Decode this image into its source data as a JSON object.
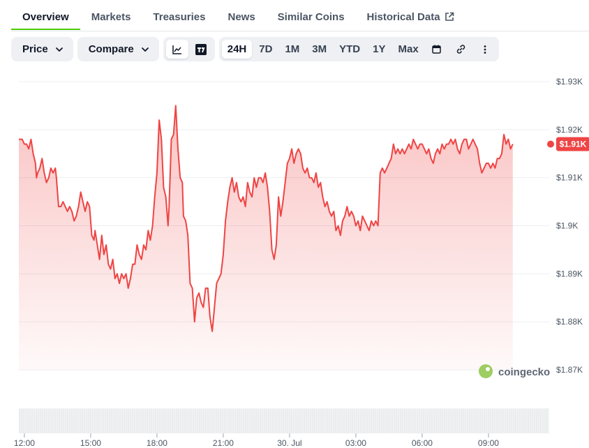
{
  "tabs": [
    {
      "label": "Overview",
      "active": true
    },
    {
      "label": "Markets"
    },
    {
      "label": "Treasuries"
    },
    {
      "label": "News"
    },
    {
      "label": "Similar Coins"
    },
    {
      "label": "Historical Data",
      "external": true
    }
  ],
  "toolbar": {
    "price_label": "Price",
    "compare_label": "Compare",
    "ranges": [
      "24H",
      "7D",
      "1M",
      "3M",
      "YTD",
      "1Y",
      "Max"
    ],
    "selected_range": "24H"
  },
  "colors": {
    "line": "#ef4444",
    "accent": "#4bcc00",
    "grid": "#eceef1"
  },
  "chart_data": {
    "type": "area",
    "ylim": [
      1870,
      1930
    ],
    "yticks": [
      1870,
      1880,
      1890,
      1900,
      1910,
      1920,
      1930
    ],
    "ytick_labels": [
      "$1.87K",
      "$1.88K",
      "$1.89K",
      "$1.9K",
      "$1.91K",
      "$1.92K",
      "$1.93K"
    ],
    "xlim": [
      11.75,
      35.75
    ],
    "xticks": [
      12,
      15,
      18,
      21,
      24,
      27,
      30,
      33
    ],
    "xtick_labels": [
      "12:00",
      "15:00",
      "18:00",
      "21:00",
      "30. Jul",
      "03:00",
      "06:00",
      "09:00"
    ],
    "current_price_label": "$1.91K",
    "watermark": "coingecko",
    "series": [
      {
        "points": [
          [
            11.75,
            1918
          ],
          [
            11.9,
            1918
          ],
          [
            12.0,
            1917
          ],
          [
            12.1,
            1917
          ],
          [
            12.2,
            1916
          ],
          [
            12.3,
            1918
          ],
          [
            12.4,
            1915
          ],
          [
            12.5,
            1913
          ],
          [
            12.55,
            1910
          ],
          [
            12.6,
            1911
          ],
          [
            12.7,
            1912
          ],
          [
            12.8,
            1914
          ],
          [
            12.9,
            1911
          ],
          [
            13.0,
            1909
          ],
          [
            13.1,
            1910
          ],
          [
            13.2,
            1912
          ],
          [
            13.3,
            1911
          ],
          [
            13.4,
            1912
          ],
          [
            13.45,
            1910
          ],
          [
            13.55,
            1904
          ],
          [
            13.65,
            1904
          ],
          [
            13.75,
            1905
          ],
          [
            13.85,
            1904
          ],
          [
            13.95,
            1903
          ],
          [
            14.05,
            1904
          ],
          [
            14.15,
            1903
          ],
          [
            14.25,
            1901
          ],
          [
            14.35,
            1902
          ],
          [
            14.45,
            1904
          ],
          [
            14.55,
            1907
          ],
          [
            14.65,
            1905
          ],
          [
            14.75,
            1903
          ],
          [
            14.85,
            1905
          ],
          [
            14.95,
            1904
          ],
          [
            15.05,
            1898
          ],
          [
            15.15,
            1897
          ],
          [
            15.2,
            1899
          ],
          [
            15.3,
            1896
          ],
          [
            15.4,
            1893
          ],
          [
            15.5,
            1898
          ],
          [
            15.6,
            1894
          ],
          [
            15.7,
            1896
          ],
          [
            15.8,
            1892
          ],
          [
            15.9,
            1891
          ],
          [
            16.0,
            1893
          ],
          [
            16.1,
            1889
          ],
          [
            16.2,
            1890
          ],
          [
            16.3,
            1888
          ],
          [
            16.4,
            1890
          ],
          [
            16.5,
            1889
          ],
          [
            16.6,
            1890
          ],
          [
            16.7,
            1887
          ],
          [
            16.8,
            1889
          ],
          [
            16.9,
            1892
          ],
          [
            17.0,
            1892
          ],
          [
            17.1,
            1896
          ],
          [
            17.2,
            1894
          ],
          [
            17.3,
            1893
          ],
          [
            17.4,
            1896
          ],
          [
            17.5,
            1895
          ],
          [
            17.6,
            1899
          ],
          [
            17.7,
            1897
          ],
          [
            17.8,
            1900
          ],
          [
            17.9,
            1906
          ],
          [
            18.0,
            1911
          ],
          [
            18.1,
            1922
          ],
          [
            18.2,
            1918
          ],
          [
            18.3,
            1908
          ],
          [
            18.4,
            1906
          ],
          [
            18.5,
            1900
          ],
          [
            18.55,
            1904
          ],
          [
            18.65,
            1918
          ],
          [
            18.75,
            1919
          ],
          [
            18.85,
            1925
          ],
          [
            18.95,
            1916
          ],
          [
            19.05,
            1910
          ],
          [
            19.15,
            1909
          ],
          [
            19.2,
            1902
          ],
          [
            19.3,
            1901
          ],
          [
            19.4,
            1898
          ],
          [
            19.5,
            1888
          ],
          [
            19.6,
            1887
          ],
          [
            19.7,
            1880
          ],
          [
            19.8,
            1885
          ],
          [
            19.9,
            1886
          ],
          [
            20.0,
            1884
          ],
          [
            20.1,
            1883
          ],
          [
            20.2,
            1887
          ],
          [
            20.3,
            1887
          ],
          [
            20.4,
            1881
          ],
          [
            20.5,
            1878
          ],
          [
            20.6,
            1883
          ],
          [
            20.7,
            1888
          ],
          [
            20.8,
            1889
          ],
          [
            20.9,
            1890
          ],
          [
            21.0,
            1894
          ],
          [
            21.1,
            1901
          ],
          [
            21.2,
            1905
          ],
          [
            21.3,
            1908
          ],
          [
            21.4,
            1910
          ],
          [
            21.5,
            1907
          ],
          [
            21.6,
            1909
          ],
          [
            21.7,
            1906
          ],
          [
            21.8,
            1905
          ],
          [
            21.9,
            1906
          ],
          [
            22.0,
            1904
          ],
          [
            22.1,
            1909
          ],
          [
            22.2,
            1907
          ],
          [
            22.3,
            1906
          ],
          [
            22.4,
            1910
          ],
          [
            22.5,
            1908
          ],
          [
            22.6,
            1910
          ],
          [
            22.7,
            1910
          ],
          [
            22.8,
            1909
          ],
          [
            22.9,
            1911
          ],
          [
            23.0,
            1908
          ],
          [
            23.1,
            1903
          ],
          [
            23.2,
            1895
          ],
          [
            23.3,
            1893
          ],
          [
            23.4,
            1896
          ],
          [
            23.5,
            1906
          ],
          [
            23.6,
            1902
          ],
          [
            23.7,
            1905
          ],
          [
            23.8,
            1909
          ],
          [
            23.9,
            1913
          ],
          [
            24.0,
            1914
          ],
          [
            24.1,
            1916
          ],
          [
            24.2,
            1913
          ],
          [
            24.3,
            1915
          ],
          [
            24.4,
            1916
          ],
          [
            24.5,
            1915
          ],
          [
            24.6,
            1912
          ],
          [
            24.7,
            1911
          ],
          [
            24.8,
            1912
          ],
          [
            24.9,
            1910
          ],
          [
            25.0,
            1910
          ],
          [
            25.1,
            1909
          ],
          [
            25.2,
            1911
          ],
          [
            25.3,
            1908
          ],
          [
            25.4,
            1909
          ],
          [
            25.5,
            1906
          ],
          [
            25.6,
            1904
          ],
          [
            25.7,
            1905
          ],
          [
            25.8,
            1903
          ],
          [
            25.9,
            1902
          ],
          [
            26.0,
            1903
          ],
          [
            26.1,
            1899
          ],
          [
            26.2,
            1900
          ],
          [
            26.3,
            1898
          ],
          [
            26.4,
            1901
          ],
          [
            26.5,
            1902
          ],
          [
            26.6,
            1904
          ],
          [
            26.7,
            1902
          ],
          [
            26.8,
            1903
          ],
          [
            26.9,
            1902
          ],
          [
            27.0,
            1900
          ],
          [
            27.1,
            1901
          ],
          [
            27.2,
            1899
          ],
          [
            27.3,
            1902
          ],
          [
            27.4,
            1901
          ],
          [
            27.5,
            1900
          ],
          [
            27.6,
            1899
          ],
          [
            27.7,
            1901
          ],
          [
            27.8,
            1900
          ],
          [
            27.9,
            1901
          ],
          [
            28.0,
            1900
          ],
          [
            28.1,
            1911
          ],
          [
            28.2,
            1912
          ],
          [
            28.3,
            1911
          ],
          [
            28.4,
            1912
          ],
          [
            28.5,
            1913
          ],
          [
            28.6,
            1914
          ],
          [
            28.7,
            1917
          ],
          [
            28.8,
            1915
          ],
          [
            28.9,
            1916
          ],
          [
            29.0,
            1915
          ],
          [
            29.1,
            1916
          ],
          [
            29.2,
            1915
          ],
          [
            29.3,
            1916
          ],
          [
            29.4,
            1917
          ],
          [
            29.5,
            1916
          ],
          [
            29.6,
            1918
          ],
          [
            29.7,
            1917
          ],
          [
            29.8,
            1916
          ],
          [
            29.9,
            1917
          ],
          [
            30.0,
            1917
          ],
          [
            30.1,
            1916
          ],
          [
            30.2,
            1915
          ],
          [
            30.3,
            1916
          ],
          [
            30.4,
            1914
          ],
          [
            30.5,
            1913
          ],
          [
            30.6,
            1915
          ],
          [
            30.7,
            1916
          ],
          [
            30.8,
            1915
          ],
          [
            30.9,
            1917
          ],
          [
            31.0,
            1916
          ],
          [
            31.1,
            1917
          ],
          [
            31.2,
            1917
          ],
          [
            31.3,
            1918
          ],
          [
            31.4,
            1917
          ],
          [
            31.5,
            1918
          ],
          [
            31.6,
            1916
          ],
          [
            31.7,
            1915
          ],
          [
            31.8,
            1917
          ],
          [
            31.9,
            1918
          ],
          [
            32.0,
            1918
          ],
          [
            32.1,
            1916
          ],
          [
            32.2,
            1917
          ],
          [
            32.3,
            1918
          ],
          [
            32.4,
            1917
          ],
          [
            32.5,
            1916
          ],
          [
            32.6,
            1913
          ],
          [
            32.7,
            1911
          ],
          [
            32.8,
            1912
          ],
          [
            32.9,
            1913
          ],
          [
            33.0,
            1913
          ],
          [
            33.1,
            1912
          ],
          [
            33.2,
            1913
          ],
          [
            33.3,
            1912
          ],
          [
            33.4,
            1914
          ],
          [
            33.5,
            1914
          ],
          [
            33.6,
            1915
          ],
          [
            33.7,
            1919
          ],
          [
            33.8,
            1917
          ],
          [
            33.9,
            1918
          ],
          [
            34.0,
            1916
          ],
          [
            34.1,
            1917
          ]
        ]
      }
    ]
  }
}
